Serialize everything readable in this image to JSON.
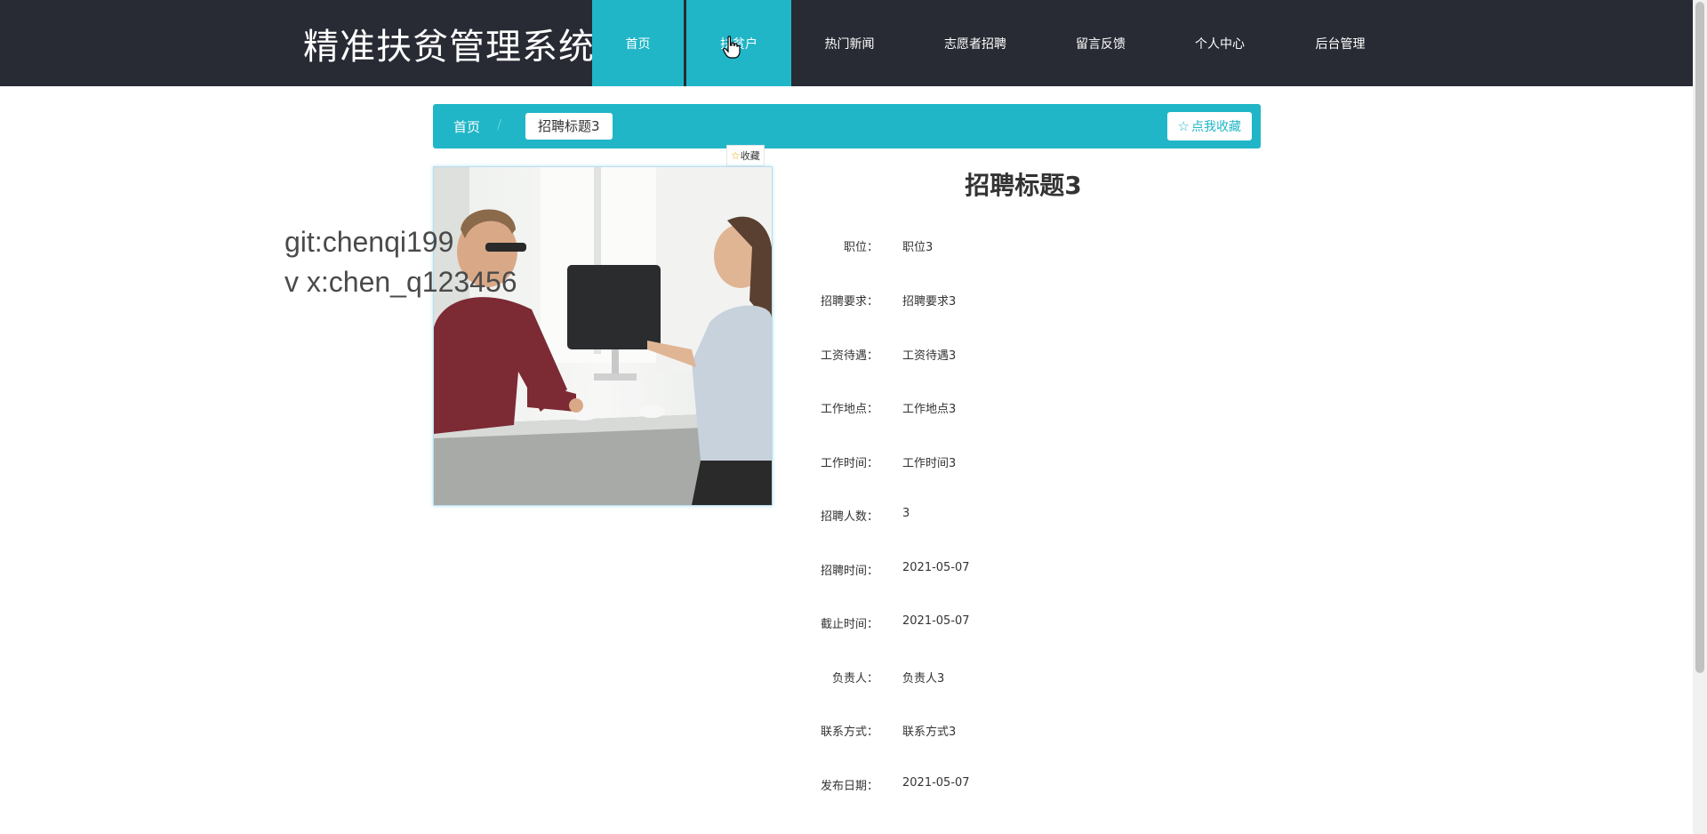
{
  "header": {
    "site_title": "精准扶贫管理系统",
    "nav": [
      {
        "label": "首页",
        "active": true
      },
      {
        "label": "扶贫户",
        "active": true
      },
      {
        "label": "热门新闻",
        "active": false
      },
      {
        "label": "志愿者招聘",
        "active": false
      },
      {
        "label": "留言反馈",
        "active": false
      },
      {
        "label": "个人中心",
        "active": false
      },
      {
        "label": "后台管理",
        "active": false
      }
    ]
  },
  "breadcrumb": {
    "home": "首页",
    "separator": "/",
    "current": "招聘标题3",
    "favorite_button": "点我收藏"
  },
  "fav_tag": "收藏",
  "watermark": "git:chenqi199\nv x:chen_q123456",
  "detail": {
    "title": "招聘标题3",
    "fields": [
      {
        "label": "职位：",
        "value": "职位3"
      },
      {
        "label": "招聘要求：",
        "value": "招聘要求3"
      },
      {
        "label": "工资待遇：",
        "value": "工资待遇3"
      },
      {
        "label": "工作地点：",
        "value": "工作地点3"
      },
      {
        "label": "工作时间：",
        "value": "工作时间3"
      },
      {
        "label": "招聘人数：",
        "value": "3"
      },
      {
        "label": "招聘时间：",
        "value": "2021-05-07"
      },
      {
        "label": "截止时间：",
        "value": "2021-05-07"
      },
      {
        "label": "负责人：",
        "value": "负责人3"
      },
      {
        "label": "联系方式：",
        "value": "联系方式3"
      },
      {
        "label": "发布日期：",
        "value": "2021-05-07"
      }
    ]
  },
  "colors": {
    "topbar": "#282b34",
    "accent": "#20b6c7"
  },
  "icons": [
    "star-outline-icon",
    "pointer-hand-icon"
  ]
}
